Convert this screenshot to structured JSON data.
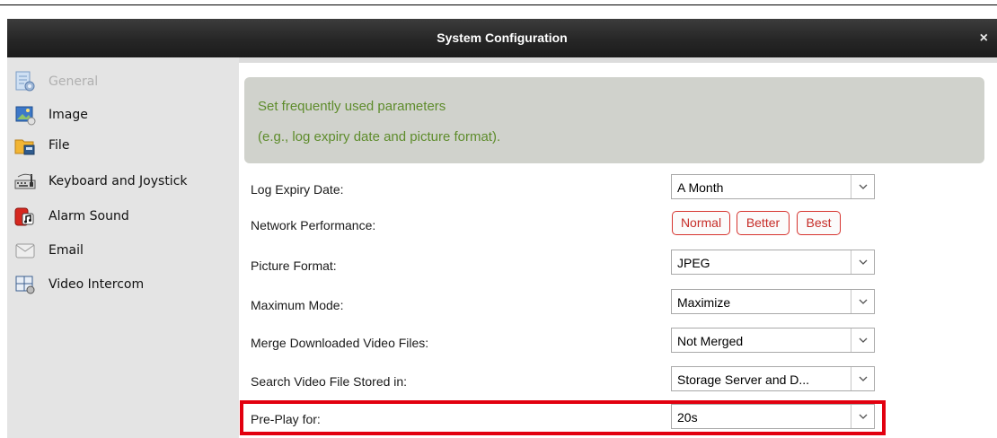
{
  "window": {
    "title": "System Configuration",
    "close_glyph": "×"
  },
  "sidebar": {
    "items": [
      {
        "label": "General",
        "icon": "settings-page-icon",
        "disabled": true
      },
      {
        "label": "Image",
        "icon": "image-icon"
      },
      {
        "label": "File",
        "icon": "folder-file-icon"
      },
      {
        "label": "Keyboard and Joystick",
        "icon": "keyboard-icon"
      },
      {
        "label": "Alarm Sound",
        "icon": "alarm-sound-icon"
      },
      {
        "label": "Email",
        "icon": "email-icon"
      },
      {
        "label": "Video Intercom",
        "icon": "video-intercom-icon"
      }
    ]
  },
  "banner": {
    "line1": "Set frequently used parameters",
    "line2": "(e.g., log expiry date and picture format)."
  },
  "settings": {
    "log_expiry": {
      "label": "Log Expiry Date:",
      "value": "A Month"
    },
    "network_performance": {
      "label": "Network Performance:",
      "options": [
        "Normal",
        "Better",
        "Best"
      ]
    },
    "picture_format": {
      "label": "Picture Format:",
      "value": "JPEG"
    },
    "maximum_mode": {
      "label": "Maximum Mode:",
      "value": "Maximize"
    },
    "merge_files": {
      "label": "Merge Downloaded Video Files:",
      "value": "Not Merged"
    },
    "search_stored": {
      "label": "Search Video File Stored in:",
      "value": "Storage Server and D..."
    },
    "pre_play": {
      "label": "Pre-Play for:",
      "value": "20s"
    }
  },
  "colors": {
    "banner_text": "#5e8c2c",
    "performance_button": "#d6342f",
    "highlight": "#e2000f"
  }
}
